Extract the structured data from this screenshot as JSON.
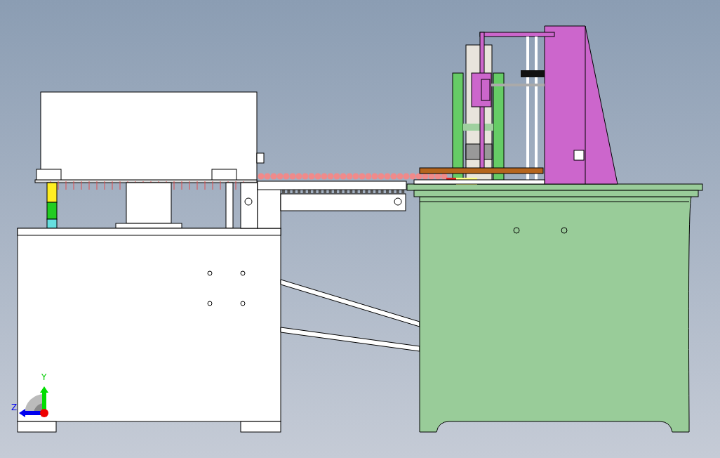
{
  "viewport": {
    "triad": {
      "labels": [
        "Y",
        "Z"
      ]
    }
  }
}
